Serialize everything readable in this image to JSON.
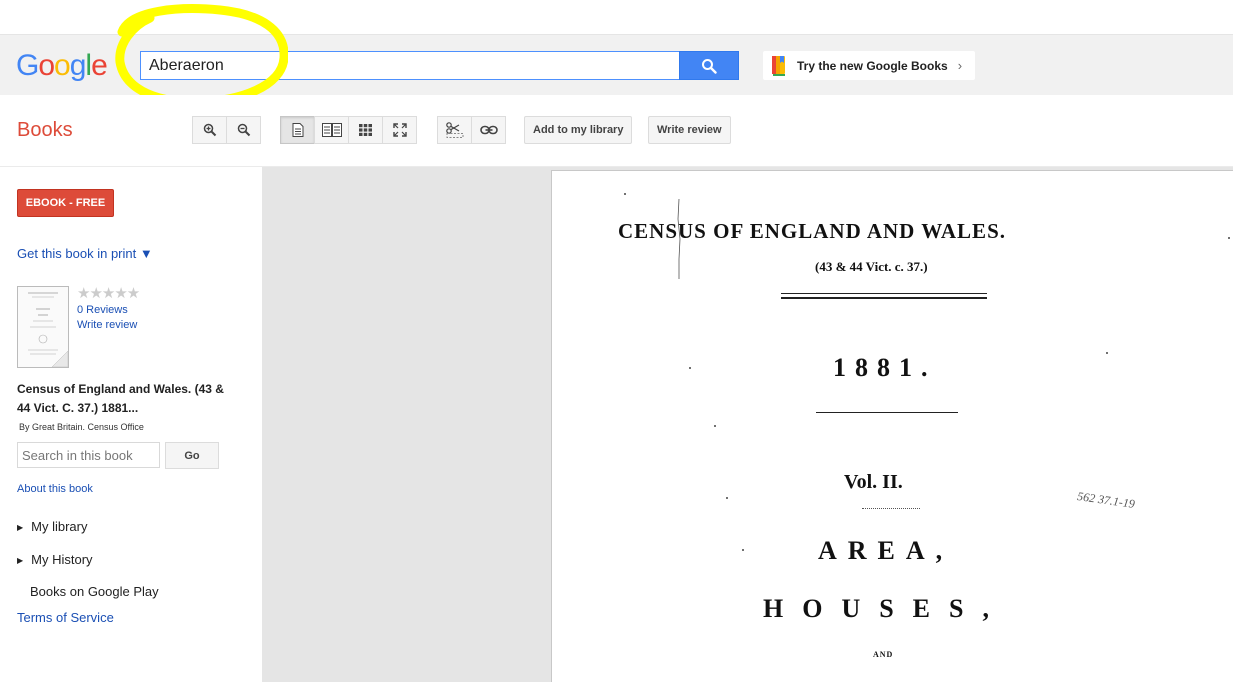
{
  "header": {
    "logo_letters": [
      {
        "ch": "G",
        "color": "#4285f4"
      },
      {
        "ch": "o",
        "color": "#ea4335"
      },
      {
        "ch": "o",
        "color": "#fbbc05"
      },
      {
        "ch": "g",
        "color": "#4285f4"
      },
      {
        "ch": "l",
        "color": "#34a853"
      },
      {
        "ch": "e",
        "color": "#ea4335"
      }
    ],
    "search_value": "Aberaeron",
    "try_label": "Try the new Google Books",
    "try_chevron": "›",
    "highlight_color": "#ffff00"
  },
  "toolbar": {
    "books_label": "Books",
    "add_library_label": "Add to my library",
    "write_review_label": "Write review",
    "icons": [
      "zoom-in-icon",
      "zoom-out-icon",
      "single-page-icon",
      "two-page-icon",
      "thumbnails-icon",
      "fullscreen-icon",
      "clip-icon",
      "link-icon"
    ]
  },
  "sidebar": {
    "ebook_label": "EBOOK - FREE",
    "get_print_label": "Get this book in print ▼",
    "stars": "★★★★★",
    "reviews_label": "0 Reviews",
    "write_review_label": "Write review",
    "book_title": "Census of England and Wales. (43 & 44 Vict. C. 37.) 1881...",
    "book_author": "By Great Britain. Census Office",
    "search_placeholder": "Search in this book",
    "go_label": "Go",
    "about_label": "About this book",
    "my_library_label": "My library",
    "my_history_label": "My History",
    "books_play_label": "Books on Google Play",
    "terms_label": "Terms of Service"
  },
  "page": {
    "title": "CENSUS OF ENGLAND AND WALES.",
    "subtitle": "(43 & 44 Vict. c. 37.)",
    "year": "1881.",
    "volume": "Vol. II.",
    "area": "AREA,",
    "houses": "HOUSES,",
    "and": "AND",
    "handwritten_note": "562 37.1-19"
  },
  "colors": {
    "brand_red": "#dd4b39",
    "link_blue": "#1a4fb4",
    "search_blue": "#4285f4"
  }
}
